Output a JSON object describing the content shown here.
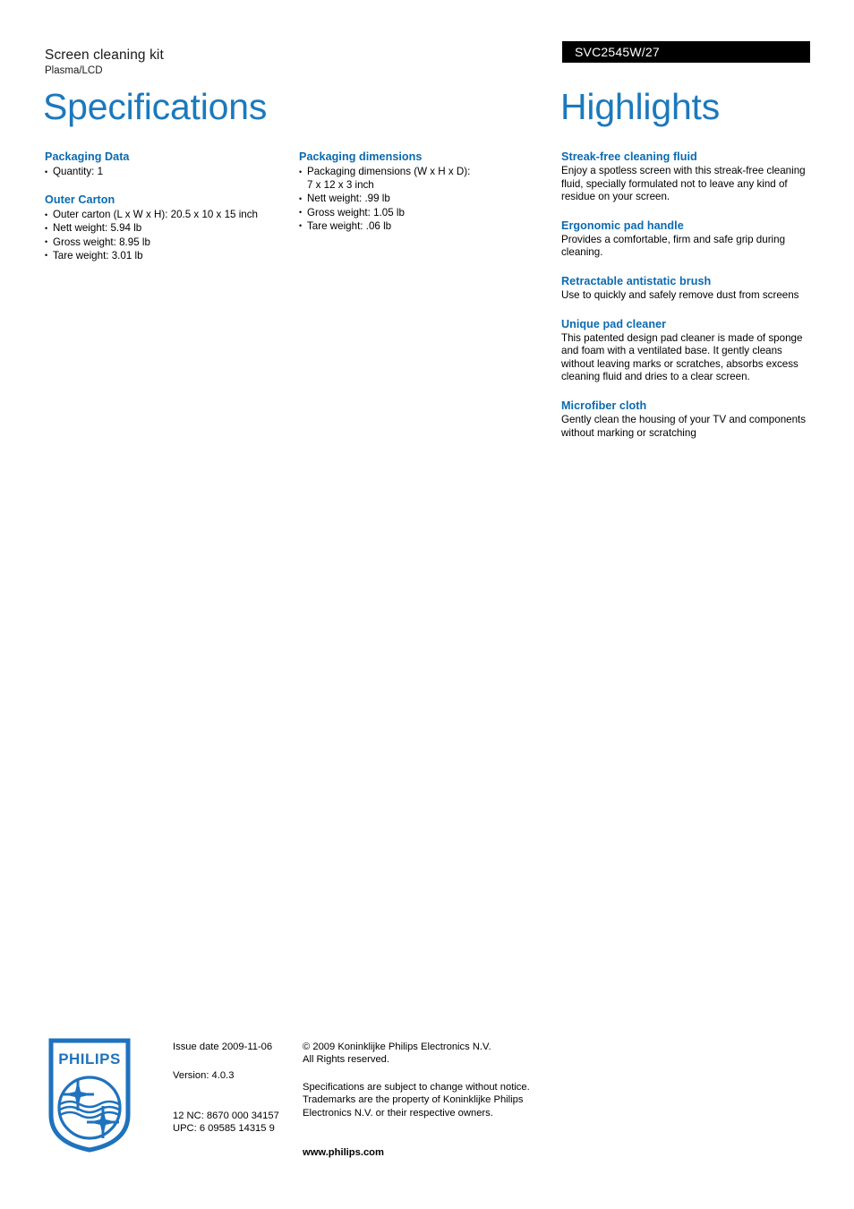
{
  "header": {
    "product_name": "Screen cleaning kit",
    "product_subtitle": "Plasma/LCD",
    "product_code": "SVC2545W/27",
    "spec_title": "Specifications",
    "highlights_title": "Highlights"
  },
  "colors": {
    "title_blue": "#1b79bd",
    "heading_blue": "#0a6ab0",
    "code_bar_bg": "#000000",
    "code_bar_text": "#ffffff",
    "logo_blue": "#1f72bd"
  },
  "specifications": {
    "column_a": [
      {
        "title": "Packaging Data",
        "items": [
          "Quantity: 1"
        ]
      },
      {
        "title": "Outer Carton",
        "items": [
          "Outer carton (L x W x H): 20.5 x 10 x 15 inch",
          "Nett weight: 5.94 lb",
          "Gross weight: 8.95 lb",
          "Tare weight: 3.01 lb"
        ]
      }
    ],
    "column_b": [
      {
        "title": "Packaging dimensions",
        "items": [
          "Packaging dimensions (W x H x D):\n7 x 12 x 3 inch",
          "Nett weight: .99 lb",
          "Gross weight: 1.05 lb",
          "Tare weight: .06 lb"
        ]
      }
    ]
  },
  "highlights": [
    {
      "title": "Streak-free cleaning fluid",
      "body": "Enjoy a spotless screen with this streak-free cleaning fluid, specially formulated not to leave any kind of residue on your screen."
    },
    {
      "title": "Ergonomic pad handle",
      "body": "Provides a comfortable, firm and safe grip during cleaning."
    },
    {
      "title": "Retractable antistatic brush",
      "body": "Use to quickly and safely remove dust from screens"
    },
    {
      "title": "Unique pad cleaner",
      "body": "This patented design pad cleaner is made of sponge and foam with a ventilated base. It gently cleans without leaving marks or scratches, absorbs excess cleaning fluid and dries to a clear screen."
    },
    {
      "title": "Microfiber cloth",
      "body": "Gently clean the housing of your TV and components without marking or scratching"
    }
  ],
  "footer": {
    "logo_wordmark": "PHILIPS",
    "issue_date": "Issue date 2009-11-06",
    "version": "Version: 4.0.3",
    "twelve_nc": "12 NC: 8670 000 34157",
    "upc": "UPC: 6 09585 14315 9",
    "copyright": "© 2009 Koninklijke Philips Electronics N.V.\nAll Rights reserved.",
    "disclaimer": "Specifications are subject to change without notice.\nTrademarks are the property of Koninklijke Philips\nElectronics N.V. or their respective owners.",
    "website": "www.philips.com"
  }
}
